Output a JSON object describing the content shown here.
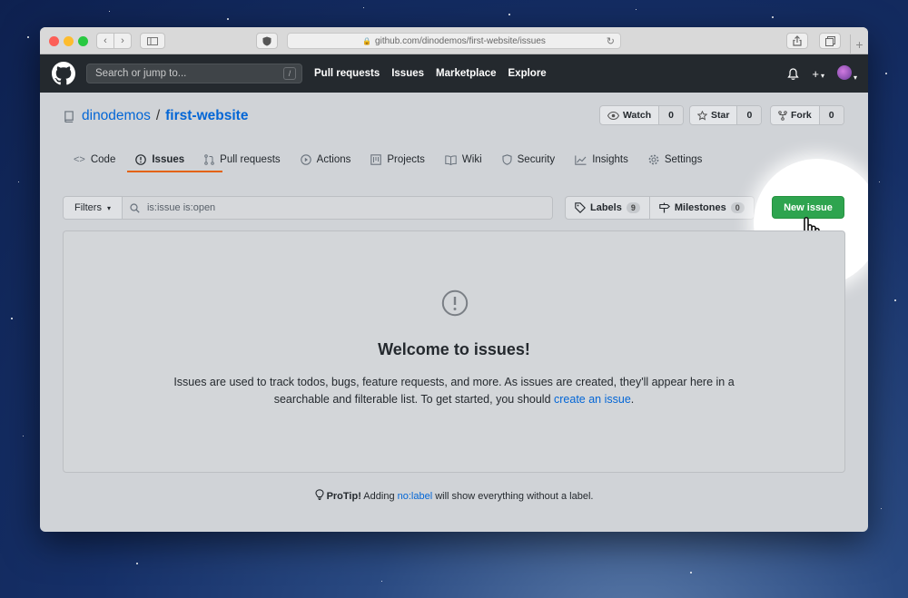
{
  "browser": {
    "url": "github.com/dinodemos/first-website/issues"
  },
  "header": {
    "search_placeholder": "Search or jump to...",
    "search_shortcut": "/",
    "nav": [
      "Pull requests",
      "Issues",
      "Marketplace",
      "Explore"
    ]
  },
  "repo": {
    "owner": "dinodemos",
    "separator": "/",
    "name": "first-website",
    "watch_label": "Watch",
    "watch_count": "0",
    "star_label": "Star",
    "star_count": "0",
    "fork_label": "Fork",
    "fork_count": "0"
  },
  "tabs": [
    {
      "label": "Code",
      "icon": "code-icon"
    },
    {
      "label": "Issues",
      "icon": "issue-opened-icon"
    },
    {
      "label": "Pull requests",
      "icon": "git-pull-request-icon"
    },
    {
      "label": "Actions",
      "icon": "play-icon"
    },
    {
      "label": "Projects",
      "icon": "project-icon"
    },
    {
      "label": "Wiki",
      "icon": "book-icon"
    },
    {
      "label": "Security",
      "icon": "shield-icon"
    },
    {
      "label": "Insights",
      "icon": "graph-icon"
    },
    {
      "label": "Settings",
      "icon": "gear-icon"
    }
  ],
  "active_tab": "Issues",
  "filters": {
    "label": "Filters",
    "query": "is:issue is:open",
    "labels_label": "Labels",
    "labels_count": "9",
    "milestones_label": "Milestones",
    "milestones_count": "0",
    "new_issue": "New issue"
  },
  "blank": {
    "title": "Welcome to issues!",
    "desc_before": "Issues are used to track todos, bugs, feature requests, and more. As issues are created, they'll appear here in a searchable and filterable list. To get started, you should ",
    "desc_link": "create an issue",
    "desc_after": "."
  },
  "protip": {
    "bold": "ProTip!",
    "before": " Adding ",
    "link": "no:label",
    "after": " will show everything without a label."
  },
  "colors": {
    "header_bg": "#24292e",
    "link": "#0366d6",
    "new_issue_bg": "#2ea44f",
    "tab_underline": "#e36209"
  }
}
